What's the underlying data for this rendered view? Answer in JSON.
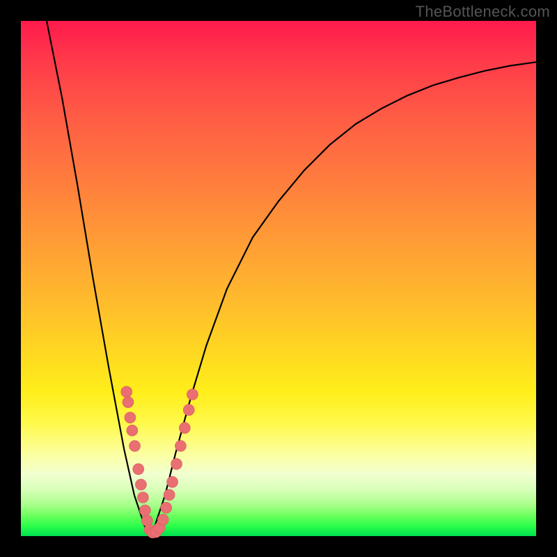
{
  "watermark": "TheBottleneck.com",
  "colors": {
    "frame": "#000000",
    "curve": "#000000",
    "marker_fill": "#e96f72",
    "marker_stroke": "#d85a60"
  },
  "chart_data": {
    "type": "line",
    "title": "",
    "xlabel": "",
    "ylabel": "",
    "xlim": [
      0,
      100
    ],
    "ylim": [
      0,
      100
    ],
    "grid": false,
    "legend": false,
    "curve_description": "V-shaped bottleneck curve; steep on the left, shallower on the right; minimum (0%) around x≈25 where it touches the green band at the bottom.",
    "x": [
      5,
      8,
      11,
      14,
      17,
      20,
      22,
      24,
      25,
      26,
      28,
      30,
      33,
      36,
      40,
      45,
      50,
      55,
      60,
      65,
      70,
      75,
      80,
      85,
      90,
      95,
      100
    ],
    "y": [
      100,
      85,
      68,
      50,
      33,
      17,
      8,
      2,
      0,
      2,
      8,
      16,
      27,
      37,
      48,
      58,
      65,
      71,
      76,
      80,
      83,
      85.5,
      87.5,
      89,
      90.3,
      91.3,
      92
    ],
    "marker_points": [
      {
        "x": 20.5,
        "y": 28
      },
      {
        "x": 20.8,
        "y": 26
      },
      {
        "x": 21.2,
        "y": 23
      },
      {
        "x": 21.6,
        "y": 20.5
      },
      {
        "x": 22.1,
        "y": 17.5
      },
      {
        "x": 22.8,
        "y": 13
      },
      {
        "x": 23.3,
        "y": 10
      },
      {
        "x": 23.7,
        "y": 7.5
      },
      {
        "x": 24.1,
        "y": 5
      },
      {
        "x": 24.5,
        "y": 3
      },
      {
        "x": 25.0,
        "y": 1.2
      },
      {
        "x": 25.6,
        "y": 0.7
      },
      {
        "x": 26.2,
        "y": 0.8
      },
      {
        "x": 26.9,
        "y": 1.6
      },
      {
        "x": 27.6,
        "y": 3.2
      },
      {
        "x": 28.2,
        "y": 5.5
      },
      {
        "x": 28.8,
        "y": 8
      },
      {
        "x": 29.4,
        "y": 10.5
      },
      {
        "x": 30.2,
        "y": 14
      },
      {
        "x": 31.0,
        "y": 17.5
      },
      {
        "x": 31.8,
        "y": 21
      },
      {
        "x": 32.6,
        "y": 24.5
      },
      {
        "x": 33.3,
        "y": 27.5
      }
    ]
  }
}
